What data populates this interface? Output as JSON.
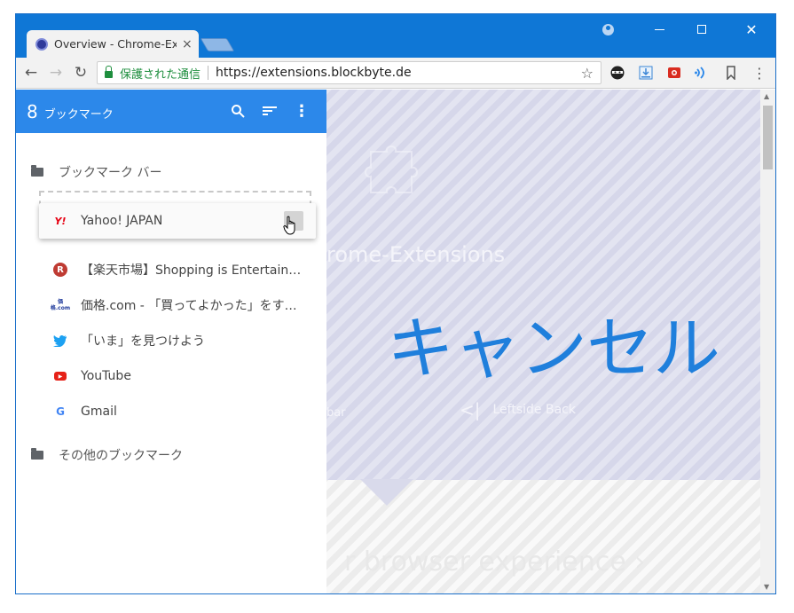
{
  "tab": {
    "title": "Overview - Chrome-Ex",
    "close": "×"
  },
  "window_controls": {
    "minimize": "",
    "maximize": "",
    "close": "✕"
  },
  "toolbar": {
    "back": "←",
    "forward": "→",
    "reload": "↻",
    "secure_label": "保護された通信",
    "url": "https://extensions.blockbyte.de",
    "star": "☆",
    "menu": "⋮"
  },
  "bookmarks_panel": {
    "count": "8",
    "title": "ブックマーク",
    "search_icon": "search-icon",
    "sort_icon": "sort-icon",
    "menu_icon": "⋮",
    "folders": [
      {
        "label": "ブックマーク バー"
      },
      {
        "label": "その他のブックマーク"
      }
    ],
    "dragging_item": {
      "label": "Yahoo! JAPAN",
      "favicon": "Y!"
    },
    "items": [
      {
        "label": "【楽天市場】Shopping is Entertain…",
        "favicon": "R"
      },
      {
        "label": "価格.com - 「買ってよかった」をす…",
        "favicon": "価格.com"
      },
      {
        "label": "「いま」を見つけよう",
        "favicon": "twitter-bird"
      },
      {
        "label": "YouTube",
        "favicon": "▶"
      },
      {
        "label": "Gmail",
        "favicon": "G"
      }
    ]
  },
  "page": {
    "faint_title": "rome-Extensions",
    "cancel_text": "キャンセル",
    "faint_left": "bar",
    "faint_back": "Leftside Back",
    "faint_browser": "r browser experience  ›"
  },
  "colors": {
    "titlebar": "#0f77d6",
    "panel_header": "#2c88ea",
    "cancel_text": "#1f7fdc",
    "secure_green": "#1e8e3e"
  }
}
